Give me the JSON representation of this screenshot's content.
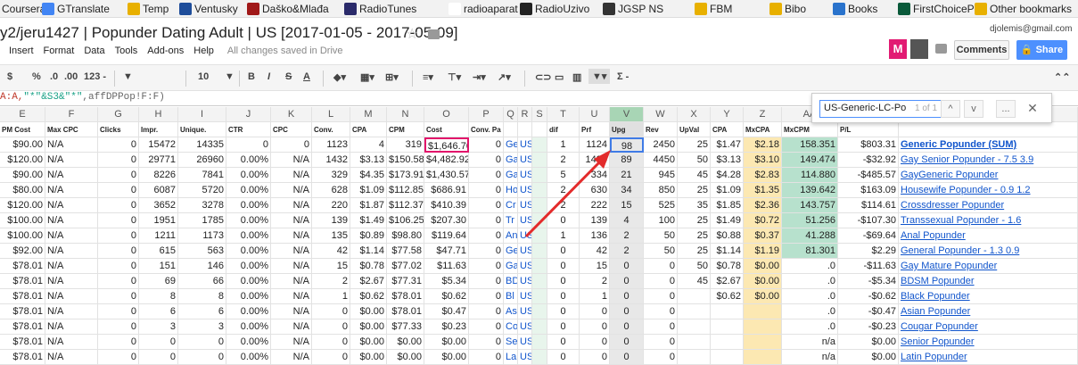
{
  "bookmarks": [
    {
      "label": "Coursera",
      "color": "#2a73cc"
    },
    {
      "label": "GTranslate",
      "color": "#4285f4"
    },
    {
      "label": "Temp",
      "color": "#e8b000"
    },
    {
      "label": "Ventusky",
      "color": "#1e4d9a"
    },
    {
      "label": "Daško&Mlađa",
      "color": "#a01818"
    },
    {
      "label": "RadioTunes",
      "color": "#2a2a6a"
    },
    {
      "label": "radioaparat",
      "color": "#ffffff"
    },
    {
      "label": "RadioUzivo",
      "color": "#222222"
    },
    {
      "label": "JGSP NS",
      "color": "#333333"
    },
    {
      "label": "FBM",
      "color": "#e8b000"
    },
    {
      "label": "Bibo",
      "color": "#e8b000"
    },
    {
      "label": "Books",
      "color": "#2a73cc"
    },
    {
      "label": "FirstChoicePay",
      "color": "#0a5a3a"
    },
    {
      "label": "Other bookmarks",
      "color": "#e8b000"
    }
  ],
  "doc": {
    "title": "y2/jeru1427 | Popunder Dating Adult | US  [2017-01-05 - 2017-05-09]",
    "email": "djolemis@gmail.com",
    "avatar_letter": "M",
    "comments": "Comments",
    "share": "Share"
  },
  "menu": {
    "items": [
      "Insert",
      "Format",
      "Data",
      "Tools",
      "Add-ons",
      "Help"
    ],
    "saved": "All changes saved in Drive"
  },
  "toolbar": {
    "currency": "$",
    "percent": "%",
    "dec0": ".0",
    "dec00": ".00",
    "format123": "123 -",
    "font_size": "10",
    "bold": "B",
    "italic": "I",
    "strike": "S",
    "textcolor": "A",
    "sigma": "Σ -"
  },
  "formula": {
    "part1": "A:A,",
    "part2": "\"*\"&S3&\"*\"",
    "part3": ",affDPPop!F:F)"
  },
  "find": {
    "value": "US-Generic-LC-Po",
    "count": "1 of 1",
    "up": "^",
    "down": "v",
    "more": "...",
    "close": "✕"
  },
  "columns": [
    "E",
    "F",
    "G",
    "H",
    "I",
    "J",
    "K",
    "L",
    "M",
    "N",
    "O",
    "P",
    "Q",
    "R",
    "S",
    "T",
    "U",
    "V",
    "W",
    "X",
    "Y",
    "Z",
    "AA",
    "AB",
    ""
  ],
  "fields": [
    "PM Cost",
    "Max CPC",
    "Clicks",
    "Impr.",
    "Unique.",
    "CTR",
    "CPC",
    "Conv.",
    "CPA",
    "CPM",
    "Cost",
    "Conv. Pa",
    "",
    "",
    "",
    "dif",
    "Prf",
    "Upg",
    "Rev",
    "UpVal",
    "CPA",
    "MxCPA",
    "MxCPM",
    "P/L",
    ""
  ],
  "rows": [
    [
      "$90.00",
      "N/A",
      "0",
      "15472",
      "14335",
      "0",
      "0",
      "1123",
      "4",
      "319",
      "$1,646.70",
      "0",
      "Generi",
      "US-",
      "",
      "1",
      "1124",
      "98",
      "2450",
      "25",
      "$1.47",
      "$2.18",
      "158.351",
      "$803.31",
      "Generic Popunder (SUM)"
    ],
    [
      "$120.00",
      "N/A",
      "0",
      "29771",
      "26960",
      "0.00%",
      "N/A",
      "1432",
      "$3.13",
      "$150.58",
      "$4,482.92",
      "0",
      "Ga",
      "US-",
      "",
      "2",
      "1434",
      "89",
      "4450",
      "50",
      "$3.13",
      "$3.10",
      "149.474",
      "-$32.92",
      "Gay Senior Popunder - 7.5  3.9"
    ],
    [
      "$90.00",
      "N/A",
      "0",
      "8226",
      "7841",
      "0.00%",
      "N/A",
      "329",
      "$4.35",
      "$173.91",
      "$1,430.57",
      "0",
      "Ga",
      "US-",
      "",
      "5",
      "334",
      "21",
      "945",
      "45",
      "$4.28",
      "$2.83",
      "114.880",
      "-$485.57",
      "GayGeneric Popunder"
    ],
    [
      "$80.00",
      "N/A",
      "0",
      "6087",
      "5720",
      "0.00%",
      "N/A",
      "628",
      "$1.09",
      "$112.85",
      "$686.91",
      "0",
      "Ho",
      "US-",
      "",
      "2",
      "630",
      "34",
      "850",
      "25",
      "$1.09",
      "$1.35",
      "139.642",
      "$163.09",
      "Housewife Popunder - 0.9  1.2"
    ],
    [
      "$120.00",
      "N/A",
      "0",
      "3652",
      "3278",
      "0.00%",
      "N/A",
      "220",
      "$1.87",
      "$112.37",
      "$410.39",
      "0",
      "Cr",
      "US-",
      "",
      "2",
      "222",
      "15",
      "525",
      "35",
      "$1.85",
      "$2.36",
      "143.757",
      "$114.61",
      "Crossdresser Popunder"
    ],
    [
      "$100.00",
      "N/A",
      "0",
      "1951",
      "1785",
      "0.00%",
      "N/A",
      "139",
      "$1.49",
      "$106.25",
      "$207.30",
      "0",
      "Tr",
      "US-",
      "",
      "0",
      "139",
      "4",
      "100",
      "25",
      "$1.49",
      "$0.72",
      "51.256",
      "-$107.30",
      "Transsexual Popunder - 1.6"
    ],
    [
      "$100.00",
      "N/A",
      "0",
      "1211",
      "1173",
      "0.00%",
      "N/A",
      "135",
      "$0.89",
      "$98.80",
      "$119.64",
      "0",
      "An",
      "US-",
      "",
      "1",
      "136",
      "2",
      "50",
      "25",
      "$0.88",
      "$0.37",
      "41.288",
      "-$69.64",
      "Anal Popunder"
    ],
    [
      "$92.00",
      "N/A",
      "0",
      "615",
      "563",
      "0.00%",
      "N/A",
      "42",
      "$1.14",
      "$77.58",
      "$47.71",
      "0",
      "Ge",
      "US-",
      "",
      "0",
      "42",
      "2",
      "50",
      "25",
      "$1.14",
      "$1.19",
      "81.301",
      "$2.29",
      "General Popunder - 1.3  0.9"
    ],
    [
      "$78.01",
      "N/A",
      "0",
      "151",
      "146",
      "0.00%",
      "N/A",
      "15",
      "$0.78",
      "$77.02",
      "$11.63",
      "0",
      "Ga",
      "US-",
      "",
      "0",
      "15",
      "0",
      "0",
      "50",
      "$0.78",
      "$0.00",
      ".0",
      "-$11.63",
      "Gay Mature Popunder"
    ],
    [
      "$78.01",
      "N/A",
      "0",
      "69",
      "66",
      "0.00%",
      "N/A",
      "2",
      "$2.67",
      "$77.31",
      "$5.34",
      "0",
      "BD",
      "US-",
      "",
      "0",
      "2",
      "0",
      "0",
      "45",
      "$2.67",
      "$0.00",
      ".0",
      "-$5.34",
      "BDSM Popunder"
    ],
    [
      "$78.01",
      "N/A",
      "0",
      "8",
      "8",
      "0.00%",
      "N/A",
      "1",
      "$0.62",
      "$78.01",
      "$0.62",
      "0",
      "Bl",
      "US-",
      "",
      "0",
      "1",
      "0",
      "0",
      "",
      "$0.62",
      "$0.00",
      ".0",
      "-$0.62",
      "Black Popunder"
    ],
    [
      "$78.01",
      "N/A",
      "0",
      "6",
      "6",
      "0.00%",
      "N/A",
      "0",
      "$0.00",
      "$78.01",
      "$0.47",
      "0",
      "As",
      "US-",
      "",
      "0",
      "0",
      "0",
      "0",
      "",
      "",
      "",
      ".0",
      "-$0.47",
      "Asian Popunder"
    ],
    [
      "$78.01",
      "N/A",
      "0",
      "3",
      "3",
      "0.00%",
      "N/A",
      "0",
      "$0.00",
      "$77.33",
      "$0.23",
      "0",
      "Co",
      "US-",
      "",
      "0",
      "0",
      "0",
      "0",
      "",
      "",
      "",
      ".0",
      "-$0.23",
      "Cougar Popunder"
    ],
    [
      "$78.01",
      "N/A",
      "0",
      "0",
      "0",
      "0.00%",
      "N/A",
      "0",
      "$0.00",
      "$0.00",
      "$0.00",
      "0",
      "Se",
      "US-",
      "",
      "0",
      "0",
      "0",
      "0",
      "",
      "",
      "",
      "n/a",
      "$0.00",
      "Senior Popunder"
    ],
    [
      "$78.01",
      "N/A",
      "0",
      "0",
      "0",
      "0.00%",
      "N/A",
      "0",
      "$0.00",
      "$0.00",
      "$0.00",
      "0",
      "La",
      "US-",
      "",
      "0",
      "0",
      "0",
      "0",
      "",
      "",
      "",
      "n/a",
      "$0.00",
      "Latin Popunder"
    ]
  ],
  "colors": {
    "green": "#b7e1cd",
    "yellow": "#fce8b2",
    "gray": "#e8e8e8",
    "selected": "#3f7be6",
    "highlight": "#e2156b",
    "arrow": "#e32b2b",
    "link": "#1155cc"
  }
}
